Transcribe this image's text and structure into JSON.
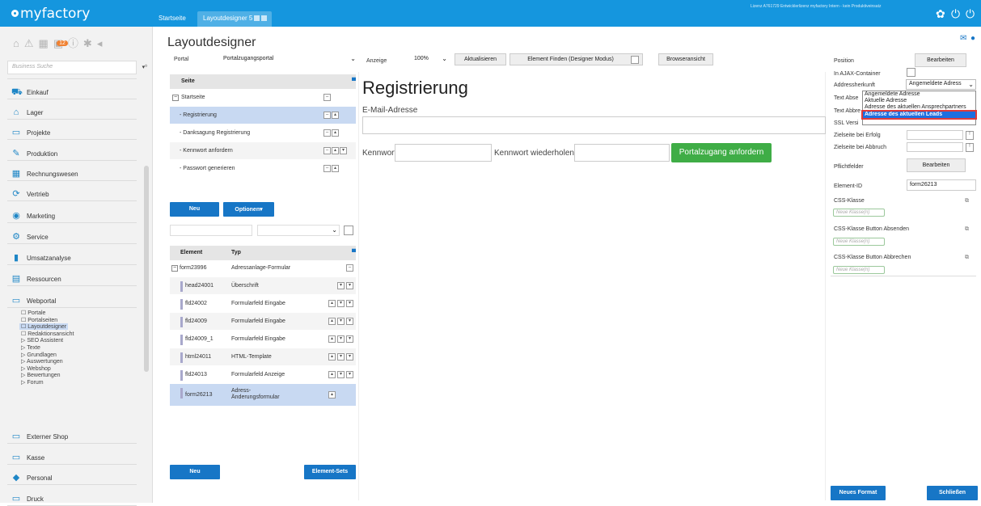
{
  "app": {
    "logo": "myfactory",
    "license": "Lizenz A761729 Entwicklerlizenz myfactory Intern - kein Produktiveinsatz"
  },
  "tabs": [
    {
      "label": "Startseite"
    },
    {
      "label": "Layoutdesigner 5"
    }
  ],
  "sidebar": {
    "search_placeholder": "Business Suche",
    "badge": "12",
    "items": [
      "Einkauf",
      "Lager",
      "Projekte",
      "Produktion",
      "Rechnungswesen",
      "Vertrieb",
      "Marketing",
      "Service",
      "Umsatzanalyse",
      "Ressourcen",
      "Webportal",
      "Externer Shop",
      "Kasse",
      "Personal",
      "Druck"
    ],
    "webportal_sub": [
      "Portale",
      "Portalseiten",
      "Layoutdesigner",
      "Redaktionsansicht",
      "SEO Assistent",
      "Texte",
      "Grundlagen",
      "Auswertungen",
      "Webshop",
      "Bewertungen",
      "Forum"
    ]
  },
  "main": {
    "title": "Layoutdesigner",
    "portal_label": "Portal",
    "portal_value": "Portalzugangsportal",
    "anzeige_label": "Anzeige",
    "zoom": "100%",
    "btn_refresh": "Aktualisieren",
    "btn_find": "Element Finden (Designer Modus)",
    "btn_browser": "Browseransicht"
  },
  "pages": {
    "header": "Seite",
    "rows": [
      "Startseite",
      "- Registrierung",
      "- Danksagung Registrierung",
      "- Kennwort anfordern",
      "- Passwort generieren"
    ],
    "btn_new": "Neu",
    "btn_options": "Optionen"
  },
  "elements": {
    "col_element": "Element",
    "col_type": "Typ",
    "rows": [
      {
        "id": "form23996",
        "type": "Adressanlage-Formular"
      },
      {
        "id": "head24001",
        "type": "Überschrift"
      },
      {
        "id": "fld24002",
        "type": "Formularfeld Eingabe"
      },
      {
        "id": "fld24009",
        "type": "Formularfeld Eingabe"
      },
      {
        "id": "fld24009_1",
        "type": "Formularfeld Eingabe"
      },
      {
        "id": "html24011",
        "type": "HTML-Template"
      },
      {
        "id": "fld24013",
        "type": "Formularfeld Anzeige"
      },
      {
        "id": "form26213",
        "type": "Adress-\nÄnderungsformular"
      }
    ],
    "btn_new": "Neu",
    "btn_sets": "Element-Sets"
  },
  "canvas": {
    "heading": "Registrierung",
    "email_label": "E-Mail-Adresse",
    "pw_label": "Kennwort",
    "pw2_label": "Kennwort wiederholen",
    "submit": "Portalzugang anfordern"
  },
  "props": {
    "position": "Position",
    "edit": "Bearbeiten",
    "ajax": "In AJAX-Container",
    "herkunft": "Addressherkunft",
    "herkunft_value": "Angemeldete Adress",
    "text_abs": "Text Abse",
    "text_abb": "Text Abbre",
    "ssl": "SSL Versi",
    "ziel_erfolg": "Zielseite bei Erfolg",
    "ziel_abbruch": "Zielseite bei Abbruch",
    "pflicht": "Pflichtfelder",
    "edit2": "Bearbeiten",
    "elid_label": "Element-ID",
    "elid_value": "form26213",
    "css": "CSS-Klasse",
    "css_absenden": "CSS-Klasse Button Absenden",
    "css_abbrechen": "CSS-Klasse Button Abbrechen",
    "class_ph": "Neue Klasse(n)",
    "dropdown": [
      "Angemeldete Adresse",
      "Aktuelle Adresse",
      "Adresse des aktuellen Ansprechpartners",
      "Adresse des aktuellen Leads"
    ]
  },
  "footer": {
    "new_format": "Neues Format",
    "close": "Schließen"
  },
  "colors": {
    "topbar": "#1596de",
    "primary_btn": "#1776c6",
    "green_btn": "#3fad46",
    "highlight": "#1e6fe0"
  }
}
